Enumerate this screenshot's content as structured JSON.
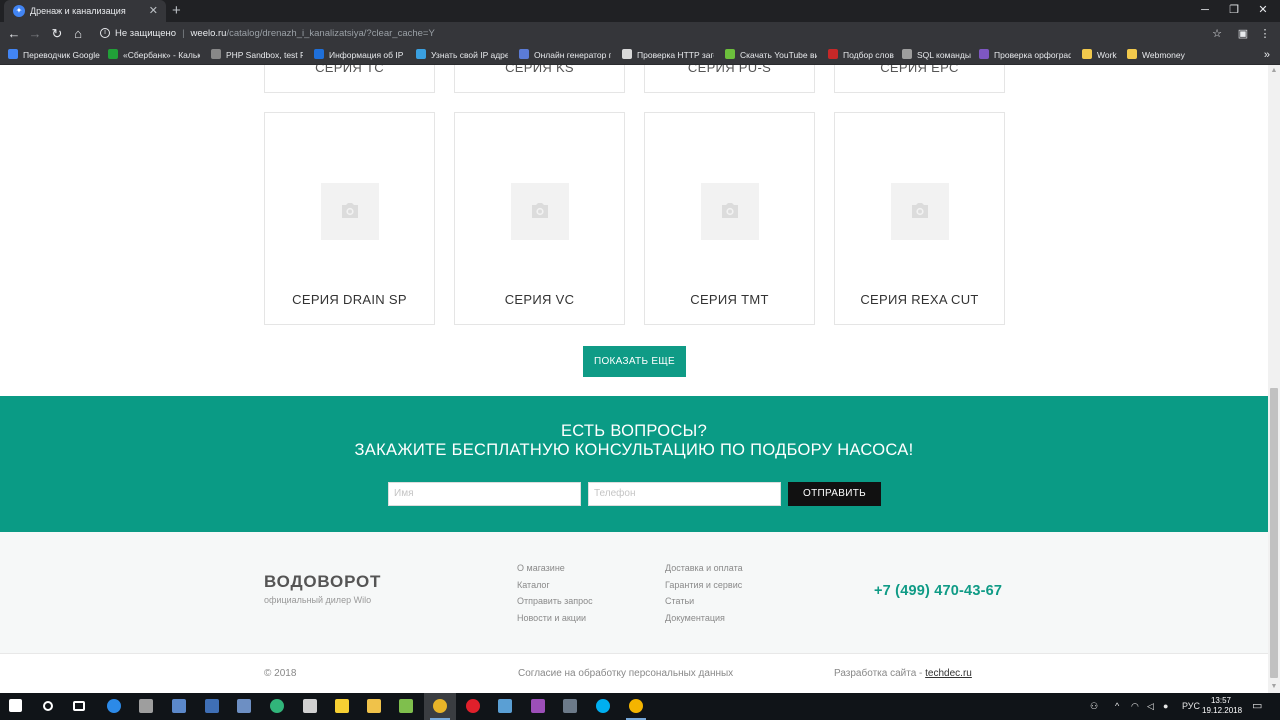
{
  "browser": {
    "tab_title": "Дренаж и канализация",
    "tab_close": "✕",
    "new_tab": "+",
    "security_label": "Не защищено",
    "url_host": "weelo.ru",
    "url_path": "/catalog/drenazh_i_kanalizatsiya/?clear_cache=Y",
    "bookmarks": [
      {
        "label": "Переводчик Google",
        "color": "#4285f4"
      },
      {
        "label": "«Сбербанк» - Кальк",
        "color": "#21a038"
      },
      {
        "label": "PHP Sandbox, test PH",
        "color": "#888888"
      },
      {
        "label": "Информация об IP а",
        "color": "#1e6fd9"
      },
      {
        "label": "Узнать свой IP адрес",
        "color": "#3aa0e0"
      },
      {
        "label": "Онлайн генератор п",
        "color": "#5b7bd5"
      },
      {
        "label": "Проверка HTTP загол",
        "color": "#d9d9d9"
      },
      {
        "label": "Скачать YouTube ви",
        "color": "#6cbf3c"
      },
      {
        "label": "Подбор слов",
        "color": "#c62828"
      },
      {
        "label": "SQL команды",
        "color": "#9e9e9e"
      },
      {
        "label": "Проверка орфограф",
        "color": "#7e57c2"
      },
      {
        "label": "Work",
        "color": "#f2c94c"
      },
      {
        "label": "Webmoney",
        "color": "#f2c94c"
      }
    ],
    "bookmarks_more": "»"
  },
  "catalog": {
    "top_cards": [
      "СЕРИЯ TC",
      "СЕРИЯ KS",
      "СЕРИЯ PU-S",
      "СЕРИЯ EPC"
    ],
    "cards": [
      "СЕРИЯ DRAIN SP",
      "СЕРИЯ VC",
      "СЕРИЯ TMT",
      "СЕРИЯ REXA CUT"
    ],
    "show_more": "ПОКАЗАТЬ ЕЩЕ"
  },
  "cta": {
    "line1": "ЕСТЬ ВОПРОСЫ?",
    "line2": "ЗАКАЖИТЕ БЕСПЛАТНУЮ КОНСУЛЬТАЦИЮ ПО ПОДБОРУ НАСОСА!",
    "name_placeholder": "Имя",
    "phone_placeholder": "Телефон",
    "submit": "ОТПРАВИТЬ"
  },
  "footer": {
    "logo": "ВОДОВОРОТ",
    "logo_sub": "официальный дилер Wilo",
    "col1": [
      "О магазине",
      "Каталог",
      "Отправить запрос",
      "Новости и акции"
    ],
    "col2": [
      "Доставка и оплата",
      "Гарантия и сервис",
      "Статьи",
      "Документация"
    ],
    "phone": "+7 (499) 470-43-67",
    "copyright": "© 2018",
    "consent": "Согласие на обработку персональных данных",
    "dev_label": "Разработка сайта - ",
    "dev_link": "techdec.ru"
  },
  "taskbar": {
    "lang": "РУС",
    "time": "13:57",
    "date": "19.12.2018"
  }
}
